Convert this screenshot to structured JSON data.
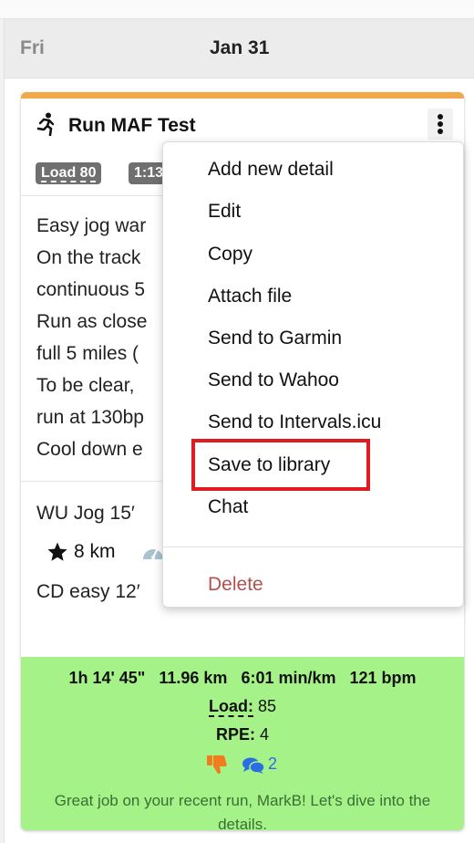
{
  "day": {
    "name": "Fri",
    "date": "Jan 31"
  },
  "workout": {
    "title": "Run MAF Test",
    "badges": [
      "Load 80",
      "1:13"
    ],
    "description_lines": [
      "Easy jog war",
      "On the track",
      "continuous 5",
      "Run as close",
      "full 5 miles (",
      "To be clear,",
      "run at 130bp",
      "Cool down e"
    ],
    "steps": {
      "warmup": "WU Jog 15′",
      "distance": "8 km",
      "cooldown": "CD easy 12′"
    },
    "accent_color": "#f0a848"
  },
  "summary": {
    "duration": "1h 14' 45\"",
    "distance": "11.96 km",
    "pace": "6:01 min/km",
    "heart_rate": "121 bpm",
    "load_label": "Load:",
    "load_value": "85",
    "rpe_label": "RPE:",
    "rpe_value": "4",
    "comments": "2",
    "message": "Great job on your recent run, MarkB! Let's dive into the details.",
    "background_color": "#a5f388"
  },
  "menu": {
    "items": [
      "Add new detail",
      "Edit",
      "Copy",
      "Attach file",
      "Send to Garmin",
      "Send to Wahoo",
      "Send to Intervals.icu",
      "Save to library",
      "Chat"
    ],
    "danger_item": "Delete",
    "highlighted_item": "Save to library",
    "highlight_color": "#e01b22"
  },
  "icons": [
    "run-icon",
    "kebab-menu-icon",
    "star-icon",
    "gauge-icon",
    "thumbs-down-icon",
    "chat-icon"
  ]
}
